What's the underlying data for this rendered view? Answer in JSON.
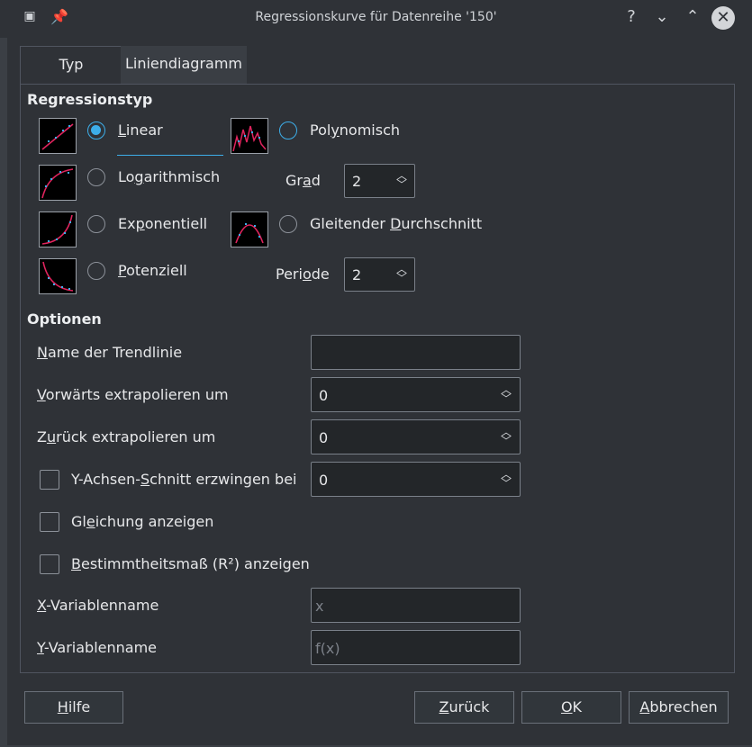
{
  "window": {
    "title": "Regressionskurve für Datenreihe '150'",
    "title_buttons": {
      "help": "?",
      "minimize": "⌄",
      "maximize": "⌃",
      "close": "✕"
    }
  },
  "tabs": [
    {
      "label": "Typ",
      "active": true
    },
    {
      "label": "Liniendiagramm",
      "active": false
    }
  ],
  "regression": {
    "section_title": "Regressionstyp",
    "types": [
      {
        "label_pre": "",
        "accel": "L",
        "label_post": "inear",
        "checked": true
      },
      {
        "label_pre": "Lo",
        "accel": "g",
        "label_post": "arithmisch",
        "checked": false
      },
      {
        "label_pre": "Ex",
        "accel": "p",
        "label_post": "onentiell",
        "checked": false
      },
      {
        "label_pre": "",
        "accel": "P",
        "label_post": "otenziell",
        "checked": false
      },
      {
        "label_pre": "Pol",
        "accel": "y",
        "label_post": "nomisch",
        "checked": false
      },
      {
        "label_pre": "Gleitender ",
        "accel": "D",
        "label_post": "urchschnitt",
        "checked": false
      }
    ],
    "degree": {
      "label_pre": "Gr",
      "accel": "a",
      "label_post": "d",
      "value": "2"
    },
    "period": {
      "label_pre": "Peri",
      "accel": "o",
      "label_post": "de",
      "value": "2"
    }
  },
  "options": {
    "section_title": "Optionen",
    "trendline_name": {
      "label_pre": "",
      "accel": "N",
      "label_post": "ame der Trendlinie",
      "value": ""
    },
    "extrapolate_forward": {
      "label_pre": "",
      "accel": "V",
      "label_post": "orwärts extrapolieren um",
      "value": "0"
    },
    "extrapolate_backward": {
      "label_pre": "Z",
      "accel": "u",
      "label_post": "rück extrapolieren um",
      "value": "0"
    },
    "force_intercept": {
      "label_pre": "Y-Achsen-",
      "accel": "S",
      "label_post": "chnitt erzwingen bei",
      "value": "0",
      "checked": false
    },
    "show_equation": {
      "label_pre": "Gl",
      "accel": "e",
      "label_post": "ichung anzeigen",
      "checked": false
    },
    "show_r2": {
      "label_pre": "",
      "accel": "B",
      "label_post": "estimmtheitsmaß (R²) anzeigen",
      "checked": false
    },
    "x_var": {
      "label_pre": "",
      "accel": "X",
      "label_post": "-Variablenname",
      "placeholder": "x"
    },
    "y_var": {
      "label_pre": "",
      "accel": "Y",
      "label_post": "-Variablenname",
      "placeholder": "f(x)"
    }
  },
  "buttons": {
    "help": {
      "label_pre": "",
      "accel": "H",
      "label_post": "ilfe"
    },
    "back": {
      "label_pre": "",
      "accel": "Z",
      "label_post": "urück"
    },
    "ok": {
      "label_pre": "",
      "accel": "O",
      "label_post": "K"
    },
    "cancel": {
      "label_pre": "",
      "accel": "A",
      "label_post": "bbrechen"
    }
  },
  "colors": {
    "accent": "#3daee9",
    "curve": "#e0245e",
    "points": "#3daee9"
  }
}
